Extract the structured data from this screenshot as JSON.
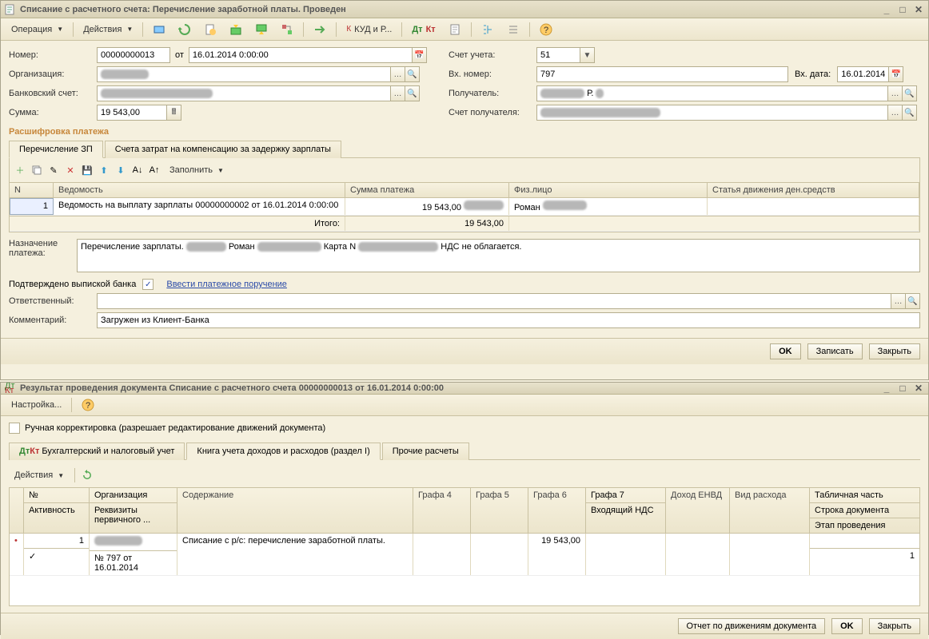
{
  "window1": {
    "title": "Списание с расчетного счета: Перечисление заработной платы. Проведен",
    "toolbar": {
      "operation": "Операция",
      "actions": "Действия",
      "kudip": "КУД и Р..."
    },
    "form": {
      "number_lbl": "Номер:",
      "number": "00000000013",
      "ot": "от",
      "date": "16.01.2014 0:00:00",
      "org_lbl": "Организация:",
      "bank_lbl": "Банковский счет:",
      "sum_lbl": "Сумма:",
      "sum": "19 543,00",
      "acct_lbl": "Счет учета:",
      "acct": "51",
      "vxnum_lbl": "Вх. номер:",
      "vxnum": "797",
      "vxdate_lbl": "Вх. дата:",
      "vxdate": "16.01.2014",
      "recipient_lbl": "Получатель:",
      "recipient_suffix": "Р.",
      "recacct_lbl": "Счет получателя:"
    },
    "group": "Расшифровка платежа",
    "tabs": {
      "t1": "Перечисление ЗП",
      "t2": "Счета затрат на компенсацию за задержку зарплаты"
    },
    "gridtb": {
      "fill": "Заполнить"
    },
    "grid": {
      "hdr": {
        "n": "N",
        "ved": "Ведомость",
        "sum": "Сумма платежа",
        "fiz": "Физ.лицо",
        "stat": "Статья движения ден.средств"
      },
      "row1": {
        "n": "1",
        "ved": "Ведомость на выплату зарплаты 00000000002 от 16.01.2014 0:00:00",
        "sum": "19 543,00",
        "fiz": "Роман"
      },
      "total": {
        "label": "Итого:",
        "sum": "19 543,00"
      }
    },
    "purpose_lbl": "Назначение платежа:",
    "purpose1": "Перечисление зарплаты.",
    "purpose2": "Роман",
    "purpose3": "Карта N",
    "purpose4": "НДС не облагается.",
    "confirmed_lbl": "Подтверждено выпиской банка",
    "payment_order": "Ввести платежное поручение",
    "resp_lbl": "Ответственный:",
    "comment_lbl": "Комментарий:",
    "comment": "Загружен из Клиент-Банка",
    "footer": {
      "ok": "OK",
      "write": "Записать",
      "close": "Закрыть"
    }
  },
  "window2": {
    "title": "Результат проведения документа Списание с расчетного счета 00000000013 от 16.01.2014 0:00:00",
    "settings": "Настройка...",
    "manual": "Ручная корректировка (разрешает редактирование движений документа)",
    "tabs": {
      "t1": "Бухгалтерский и налоговый учет",
      "t2": "Книга учета доходов и расходов (раздел I)",
      "t3": "Прочие расчеты"
    },
    "actions": "Действия",
    "grid": {
      "hdr": {
        "num": "№",
        "akt": "Активность",
        "org": "Организация",
        "rekv": "Реквизиты первичного ...",
        "sod": "Содержание",
        "g4": "Графа 4",
        "g5": "Графа 5",
        "g6": "Графа 6",
        "g7": "Графа 7",
        "vnds": "Входящий НДС",
        "denvd": "Доход ЕНВД",
        "vid": "Вид расхода",
        "tabp": "Табличная часть",
        "str": "Строка документа",
        "etap": "Этап проведения"
      },
      "row": {
        "num": "1",
        "rekv": "№ 797 от 16.01.2014",
        "sod": "Списание с р/с: перечисление заработной платы.",
        "g6": "19 543,00",
        "str": "1"
      }
    },
    "footer": {
      "report": "Отчет по движениям документа",
      "ok": "OK",
      "close": "Закрыть"
    }
  }
}
